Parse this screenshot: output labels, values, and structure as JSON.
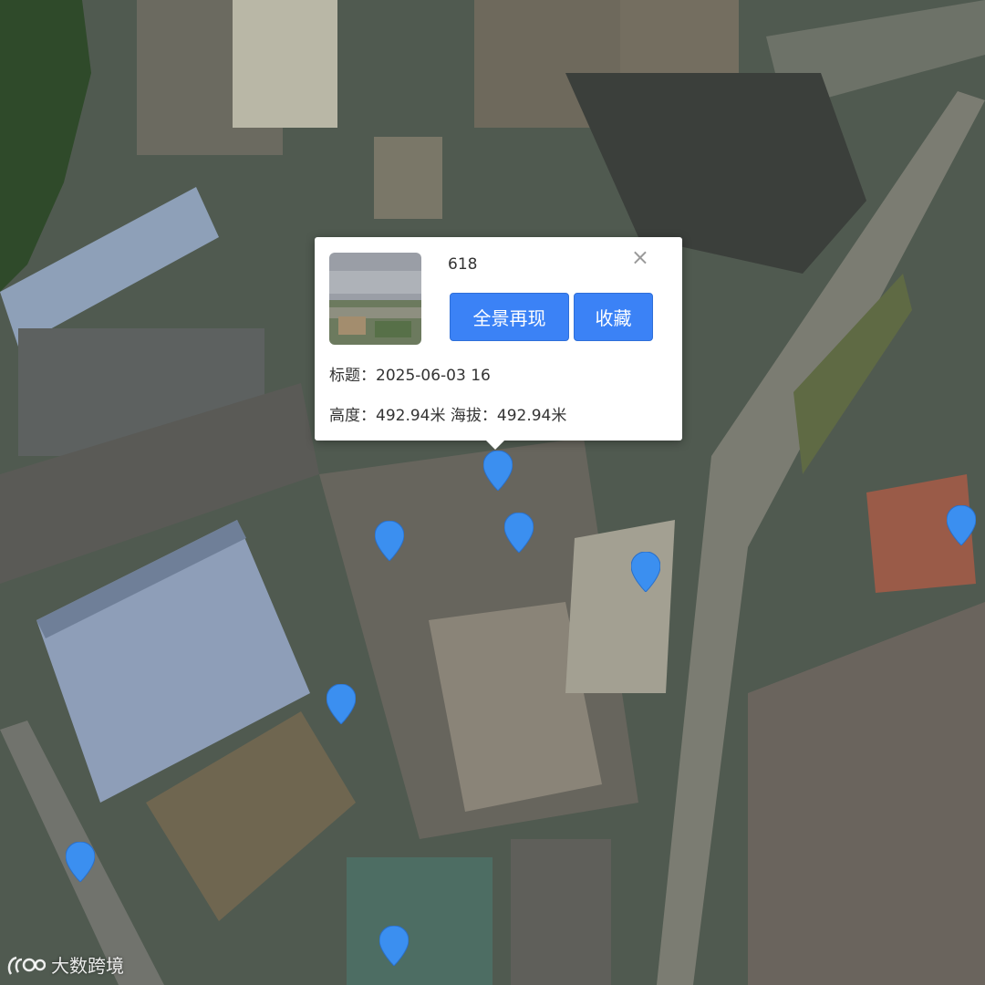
{
  "map": {
    "type": "satellite",
    "marker_color": "#3b8ff0"
  },
  "markers": [
    {
      "id": 1
    },
    {
      "id": 2
    },
    {
      "id": 3
    },
    {
      "id": 4
    },
    {
      "id": 5
    },
    {
      "id": 6
    },
    {
      "id": 7
    },
    {
      "id": 8
    }
  ],
  "popup": {
    "id_text": "618",
    "close_label": "×",
    "pano_button": "全景再现",
    "favorite_button": "收藏",
    "title_label": "标题：",
    "title_value": "2025-06-03 16",
    "height_label": "高度：",
    "height_value": "492.94米",
    "altitude_label": "海拔：",
    "altitude_value": "492.94米",
    "thumbnail_icon": "panorama-thumbnail",
    "button_color": "#3b82f6"
  },
  "watermark": {
    "logo_icon": "brand-logo-icon",
    "text": "大数跨境"
  }
}
